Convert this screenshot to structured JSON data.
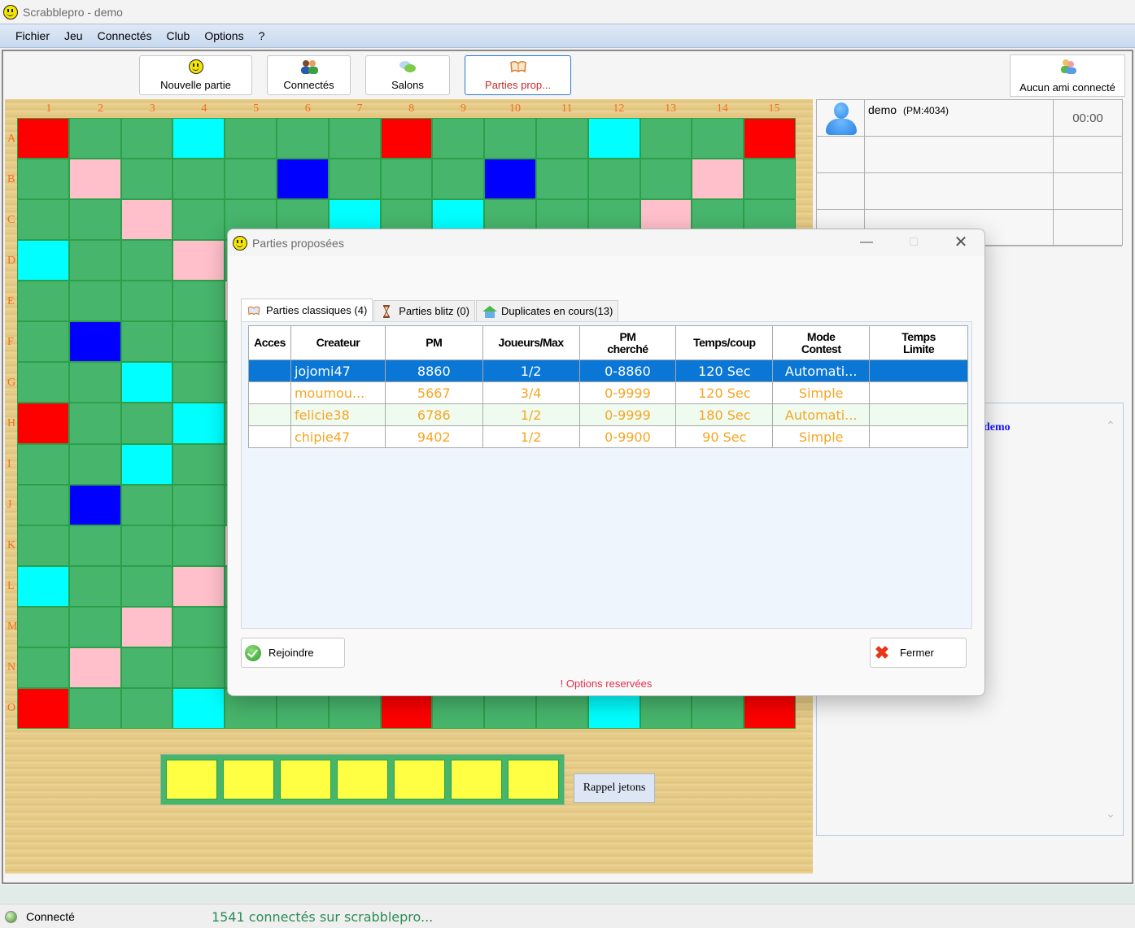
{
  "window": {
    "title": "Scrabblepro - demo"
  },
  "menu": [
    "Fichier",
    "Jeu",
    "Connectés",
    "Club",
    "Options",
    "?"
  ],
  "toolbar": {
    "new_game": "Nouvelle partie",
    "connected": "Connectés",
    "rooms": "Salons",
    "proposed_games": "Parties prop..."
  },
  "friends": {
    "label": "Aucun ami connecté"
  },
  "board": {
    "columns": [
      "1",
      "2",
      "3",
      "4",
      "5",
      "6",
      "7",
      "8",
      "9",
      "10",
      "11",
      "12",
      "13",
      "14",
      "15"
    ],
    "rows": [
      "A",
      "B",
      "C",
      "D",
      "E",
      "F",
      "G",
      "H",
      "I",
      "J",
      "K",
      "L",
      "M",
      "N",
      "O"
    ],
    "colors": {
      "normal": "#47b56c",
      "triple_word": "#ff0000",
      "double_word": "#ffc0cb",
      "triple_letter": "#0000ff",
      "double_letter": "#00ffff"
    }
  },
  "rack": {
    "tile_count": 7,
    "tile_color": "#ffff44",
    "recall_label": "Rappel jetons"
  },
  "players": [
    {
      "name": "demo",
      "pm": "(PM:4034)",
      "time": "00:00"
    }
  ],
  "chat": {
    "user": "demo"
  },
  "status": {
    "connection": "Connecté",
    "message": "1541 connectés sur scrabblepro..."
  },
  "dialog": {
    "title": "Parties proposées",
    "tabs": [
      {
        "label": "Parties classiques (4)",
        "active": true
      },
      {
        "label": "Parties blitz (0)",
        "active": false
      },
      {
        "label": "Duplicates en cours(13)",
        "active": false
      }
    ],
    "columns": [
      "Acces",
      "Createur",
      "PM",
      "Joueurs/Max",
      "PM\ncherché",
      "Temps/coup",
      "Mode\nContest",
      "Temps\nLimite"
    ],
    "column_labels": {
      "acces": "Acces",
      "createur": "Createur",
      "pm": "PM",
      "joueurs": "Joueurs/Max",
      "pm_cherche_1": "PM",
      "pm_cherche_2": "cherché",
      "temps": "Temps/coup",
      "mode_1": "Mode",
      "mode_2": "Contest",
      "limite_1": "Temps",
      "limite_2": "Limite"
    },
    "rows": [
      {
        "acces": "",
        "createur": "jojomi47",
        "pm": "8860",
        "joueurs": "1/2",
        "pm_cherche": "0-8860",
        "temps": "120 Sec",
        "mode": "Automati...",
        "limite": "",
        "selected": true
      },
      {
        "acces": "",
        "createur": "moumou...",
        "pm": "5667",
        "joueurs": "3/4",
        "pm_cherche": "0-9999",
        "temps": "120 Sec",
        "mode": "Simple",
        "limite": ""
      },
      {
        "acces": "",
        "createur": "felicie38",
        "pm": "6786",
        "joueurs": "1/2",
        "pm_cherche": "0-9999",
        "temps": "180 Sec",
        "mode": "Automati...",
        "limite": ""
      },
      {
        "acces": "",
        "createur": "chipie47",
        "pm": "9402",
        "joueurs": "1/2",
        "pm_cherche": "0-9900",
        "temps": "90 Sec",
        "mode": "Simple",
        "limite": ""
      }
    ],
    "join_label": "Rejoindre",
    "close_label": "Fermer",
    "options_note": "! Options reservées",
    "colors": {
      "selected_row": "#0a77d6",
      "row_text": "#f5a623",
      "note": "#e2304a"
    }
  }
}
